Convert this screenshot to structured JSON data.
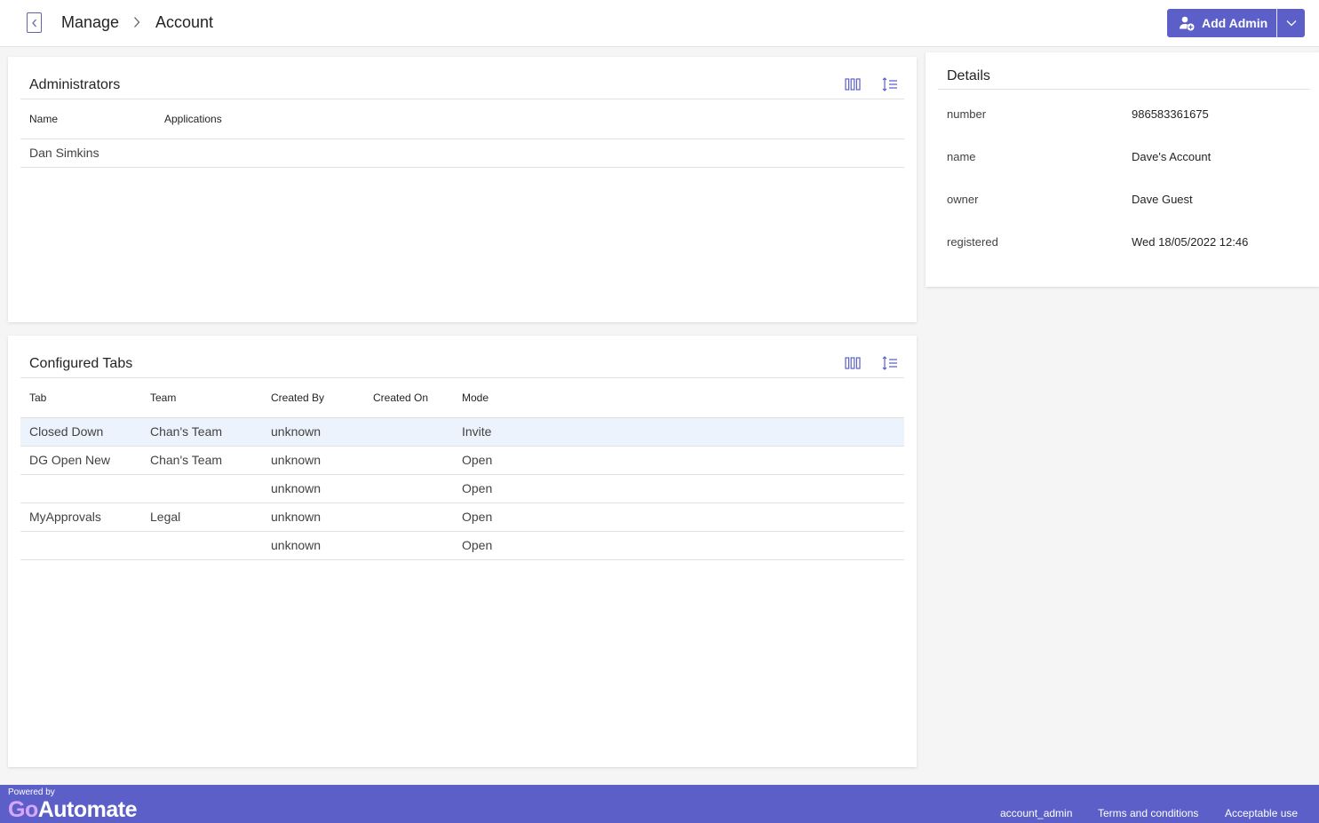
{
  "header": {
    "breadcrumb": [
      "Manage",
      "Account"
    ],
    "add_admin_label": "Add Admin"
  },
  "administrators": {
    "title": "Administrators",
    "columns": [
      "Name",
      "Applications"
    ],
    "rows": [
      {
        "name": "Dan Simkins",
        "applications": ""
      }
    ]
  },
  "configured_tabs": {
    "title": "Configured Tabs",
    "columns": [
      "Tab",
      "Team",
      "Created By",
      "Created On",
      "Mode"
    ],
    "rows": [
      {
        "tab": "Closed Down",
        "team": "Chan's Team",
        "created_by": "unknown",
        "created_on": "",
        "mode": "Invite"
      },
      {
        "tab": "DG Open New",
        "team": "Chan's Team",
        "created_by": "unknown",
        "created_on": "",
        "mode": "Open"
      },
      {
        "tab": "",
        "team": "",
        "created_by": "unknown",
        "created_on": "",
        "mode": "Open"
      },
      {
        "tab": "MyApprovals",
        "team": "Legal",
        "created_by": "unknown",
        "created_on": "",
        "mode": "Open"
      },
      {
        "tab": "",
        "team": "",
        "created_by": "unknown",
        "created_on": "",
        "mode": "Open"
      }
    ]
  },
  "details": {
    "title": "Details",
    "items": [
      {
        "key": "number",
        "value": "986583361675"
      },
      {
        "key": "name",
        "value": "Dave's Account"
      },
      {
        "key": "owner",
        "value": "Dave Guest"
      },
      {
        "key": "registered",
        "value": "Wed 18/05/2022 12:46"
      }
    ]
  },
  "footer": {
    "powered_by": "Powered by",
    "logo_go": "Go",
    "logo_rest": "Automate",
    "links": [
      "account_admin",
      "Terms and conditions",
      "Acceptable use"
    ]
  },
  "colors": {
    "accent": "#5b5fc7",
    "selected_row": "#edf3fc"
  },
  "icons": {
    "back": "chevron-left-icon",
    "separator": "chevron-right-icon",
    "add_admin": "person-add-icon",
    "dropdown": "chevron-down-icon",
    "columns": "columns-icon",
    "density": "row-density-icon"
  }
}
